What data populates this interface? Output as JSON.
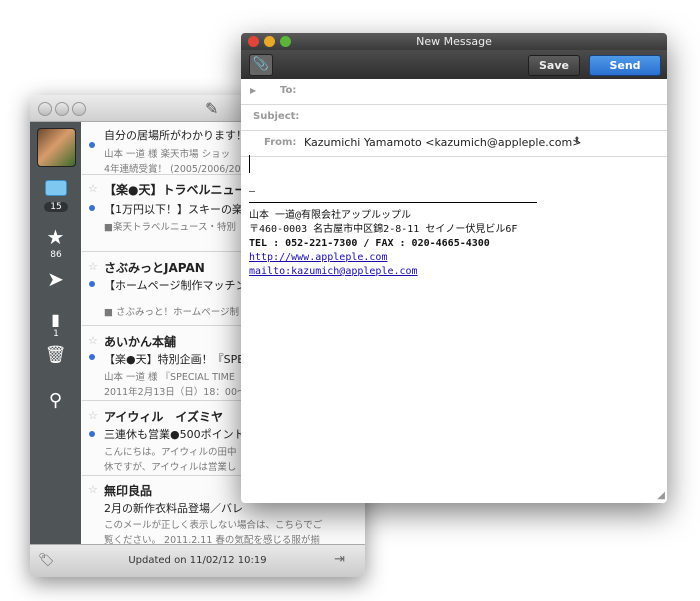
{
  "compose": {
    "window_title": "New Message",
    "save_label": "Save",
    "send_label": "Send",
    "to_label": "To:",
    "subject_label": "Subject:",
    "from_label": "From:",
    "from_value": "Kazumichi Yamamoto <kazumich@appleple.com>",
    "signature": {
      "dash": "–",
      "line1": "山本 一道@有限会社アップルップル",
      "line2": "〒460-0003 名古屋市中区錦2-8-11 セイノー伏見ビル6F",
      "line3": "TEL : 052-221-7300 / FAX : 020-4665-4300",
      "link1": "http://www.appleple.com",
      "link2": "mailto:kazumich@appleple.com"
    }
  },
  "mail_list": {
    "sidebar": {
      "inbox_count": "15",
      "starred_count": "86",
      "drafts_count": "1"
    },
    "items": [
      {
        "subject": "自分の居場所がわかります！",
        "preview1": "山本 一道 様 楽天市場 ショッ",
        "preview2": "4年連続受賞！ (2005/2006/200"
      },
      {
        "sender": "【楽●天】トラベルニュー",
        "subject": "【1万円以下！】スキーの楽",
        "preview1": "■楽天トラベルニュース・特別"
      },
      {
        "sender": "さぶみっとJAPAN",
        "subject": "【ホームページ制作マッチン",
        "preview1": "■ さぶみっと！ホームページ制"
      },
      {
        "sender": "あいかん本舗",
        "subject": "【楽●天】特別企画！『SPE",
        "preview1": "山本 一道 様 『SPECIAL TIME",
        "preview2": "2011年2月13日（日）18：00〜"
      },
      {
        "sender": "アイウィル　イズミヤ",
        "subject": "三連休も営業●500ポイント",
        "preview1": "こんにちは。アイウィルの田中",
        "preview2": "休ですが、アイウィルは営業し"
      },
      {
        "sender": "無印良品",
        "subject": "2月の新作衣料品登場／バレ",
        "preview1": "このメールが正しく表示しない場合は、こちらでご",
        "preview2": "覧ください。 2011.2.11 春の気配を感じる服が揃"
      }
    ],
    "status_text": "Updated on 11/02/12 10:19"
  }
}
